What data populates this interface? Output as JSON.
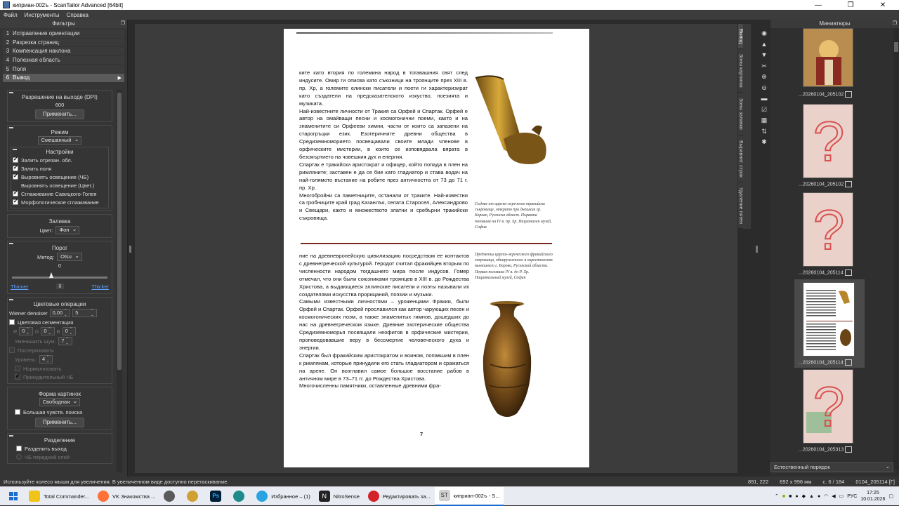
{
  "window": {
    "title": "киприан-002ъ - ScanTailor Advanced [64bit]",
    "controls": [
      "—",
      "❐",
      "✕"
    ]
  },
  "menu": [
    "Файл",
    "Инструменты",
    "Справка"
  ],
  "filters_panel": {
    "title": "Фильтры",
    "items": [
      {
        "n": "1",
        "label": "Исправление ориентации"
      },
      {
        "n": "2",
        "label": "Разрезка страниц"
      },
      {
        "n": "3",
        "label": "Компенсация наклона"
      },
      {
        "n": "4",
        "label": "Полезная область"
      },
      {
        "n": "5",
        "label": "Поля"
      },
      {
        "n": "6",
        "label": "Вывод"
      }
    ]
  },
  "options": {
    "dpi": {
      "title": "Разрешение на выходе (DPI)",
      "value": "600",
      "apply": "Применить..."
    },
    "mode": {
      "title": "Режим",
      "value": "Смешанный"
    },
    "settings": {
      "title": "Настройки",
      "checks": [
        {
          "label": "Залить отрезан. обл.",
          "on": true
        },
        {
          "label": "Залить поля",
          "on": true
        },
        {
          "label": "Выровнять освещение (ЧБ)",
          "on": true
        },
        {
          "label": "Выровнять освещение (Цвет.)",
          "on": false
        },
        {
          "label": "Сглаживание Савицкого-Голея",
          "on": true
        },
        {
          "label": "Морфологическое сглаживание",
          "on": true
        }
      ]
    },
    "fill": {
      "title": "Заливка",
      "color_label": "Цвет:",
      "color_value": "Фон"
    },
    "threshold": {
      "title": "Порог",
      "method_label": "Метод:",
      "method_value": "Otsu",
      "value": "0",
      "thinner": "Thinner",
      "thicker": "Thicker"
    },
    "color_ops": {
      "title": "Цветовые операции",
      "wiener_label": "Wiener denoiser",
      "wiener_a": "0,00",
      "wiener_b": "5",
      "segmentation": "Цветовая сегментация",
      "r_label": "R",
      "r_value": "0",
      "g_label": "G",
      "g_value": "0",
      "b_label": "B",
      "b_value": "0",
      "noise_label": "Уменьшить шум:",
      "noise_value": "7",
      "posterize": "Постеризовать",
      "levels_label": "Уровень:",
      "levels_value": "4",
      "normalize": "Нормализовать",
      "force_bw": "Принудительный ЧБ"
    },
    "picture_shape": {
      "title": "Форма картинок",
      "value": "Свободная",
      "big_search": "Большая чувств. поиска",
      "apply": "Применить..."
    },
    "split": {
      "title": "Разделение",
      "split_output": "Разделить выход",
      "bw_fg": "ЧБ передний слой"
    }
  },
  "page": {
    "text_top": "ките като втория по големина народ в тогавашния свят след индусите. Омир ги описва като съюзници на троянците през XIII в. пр. Хр, а големите елински писатели и поети ги характеризират като създатели на предсказателското изкуство, поезията и музиката.\n    Най-известните личности от Тракия са Орфей и Спартак. Орфей е автор на омайващи песни и космогонични поеми, както и на знаменитите си Орфееви химни, части от които са запазени на старогръцки език. Езотеричните древни общества в Средиземноморието посвещавали своите млади членове в орфическите мистерии, в които се изповядвала вярата в безсмъртието на човешкия дух и енергия.\n    Спартак е тракийски аристократ и офицер, който попада в плен на римляните; заставен е да се бие като гладиатор и става водач на най-голямото въстание на робите през античността от 73 до 71 г. пр. Хр.\n    Многобройни са паметниците, останали от траките. Най-известни са гробниците край град Казанлък, селата Старосел, Александрово и Свещари, както и множеството златни и сребърни тракийски съкровища.",
    "caption_top": "Съдове от царско-жреческо тракийско съкровище, открито при днешния гр. Борово, Русенска област. Първата половина на IV в. пр. Хр. Национален музей, София",
    "text_bottom": "ние на древневропейскую цивилизацию посредством ее контактов с древнегреческой культурой. Геродот считал фракийцев вторым по численности народом тогдашнего мира после индусов. Гомер отмечал, что они были союзниками троянцев в XIII в. до Рождества Христова, а выдающиеся эллинские писатели и поэты называли их создателями искусства прорицаний, поэзии и музыки.\n    Самыми известными личностями – уроженцами Фракии, были Орфей и Спартак. Орфей прославился как автор чарующих песен и космогонических поэм, а также знаменитых гимнов, дошедших до нас на древнегреческом языке. Древние эзотерические общества Средиземноморья посвящали неофитов в орфические мистерии, проповедовавшие веру в бессмертие человеческого духа и энергии.\n    Спартак был фракийским аристократом и воином, попавшим в плен к римлянам, которые принудили его стать гладиатором и сражаться на арене. Он возглавил самое большое восстание рабов в античном мире в 73–71 гг. до Рождества Христова.\n    Многочисленны памятники, оставленные древними фра-",
    "caption_bottom": "Предметы царско-жреческого фракийского сокровища, обнаруженного в окрестностях нынешнего г. Борово, Русенской области. Первая половина IV в. до Р. Хр. Национальный музей, София",
    "page_number": "7"
  },
  "side_tabs": [
    "Вывод",
    "Зоны картинок",
    "Зоны заливки",
    "Выравнит. строк",
    "Удаление пятен"
  ],
  "thumbnails": {
    "title": "Миниатюры",
    "items": [
      {
        "label": "...20260104_205102"
      },
      {
        "label": "...20260104_205102"
      },
      {
        "label": "...20260104_205114"
      },
      {
        "label": "...20260104_205114"
      },
      {
        "label": "...20260104_205313"
      }
    ],
    "sort": "Естественный порядок"
  },
  "status": {
    "hint": "Используйте колесо мыши для увеличения. В увеличенном виде доступно перетаскивание.",
    "coords": "891, 222",
    "size": "692 x 996 мм",
    "page": "с. 6 / 184",
    "file": "0104_205114 [Г]"
  },
  "taskbar": {
    "items": [
      {
        "label": "Total Commander...",
        "color": "#f0c419"
      },
      {
        "label": "VK Знакомства ...",
        "color": "#ff7139"
      },
      {
        "label": "",
        "color": "#5a5a5a"
      },
      {
        "label": "",
        "color": "#d0a030"
      },
      {
        "label": "",
        "color": "#001e36"
      },
      {
        "label": "",
        "color": "#1e8a8a"
      },
      {
        "label": "Избранное – (1)",
        "color": "#2aa3e0"
      },
      {
        "label": "NitroSense",
        "color": "#222222"
      },
      {
        "label": "Редактировать за...",
        "color": "#d2232a"
      },
      {
        "label": "киприан-002ъ - S...",
        "color": "#d0d0d0"
      }
    ],
    "lang": "РУС",
    "time": "17:25",
    "date": "10.01.2026"
  }
}
